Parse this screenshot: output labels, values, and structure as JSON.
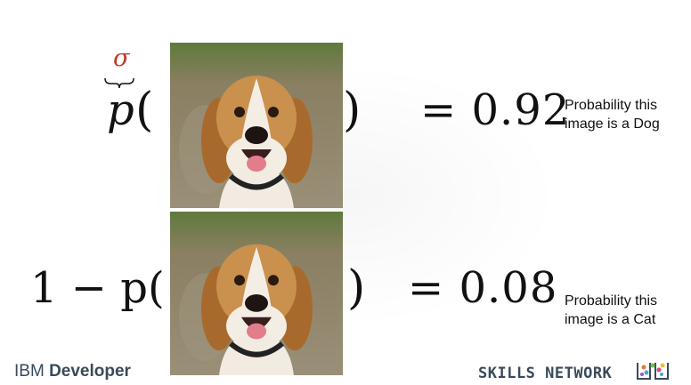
{
  "formula_top": {
    "activation_symbol": "σ",
    "function": "p",
    "open_paren": "(",
    "close_paren": ")",
    "result": "= 0.92",
    "note_line1": "Probability this",
    "note_line2": "image is a Dog"
  },
  "formula_bottom": {
    "prefix": "1 − p(",
    "close_paren": ")",
    "result": "= 0.08",
    "note_line1": "Probability this",
    "note_line2": "image is a Cat"
  },
  "footer": {
    "ibm_part1": "IBM ",
    "ibm_part2": "Developer",
    "skills_network": "SKILLS NETWORK"
  },
  "colors": {
    "sigma": "#c0392b",
    "brand_text": "#3a4a5a"
  }
}
